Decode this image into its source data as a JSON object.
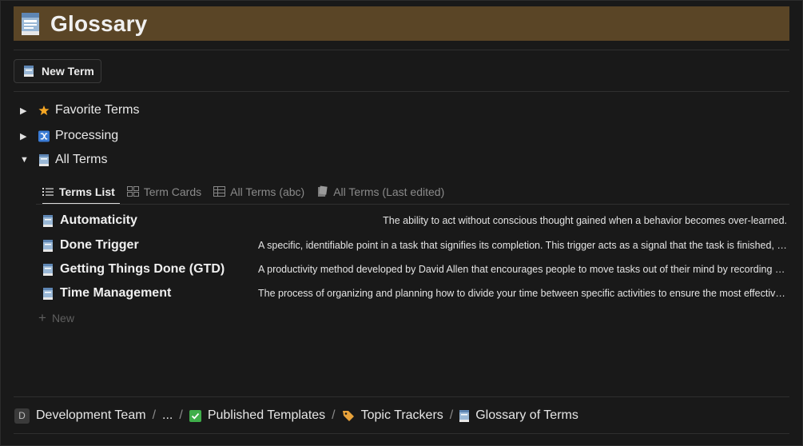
{
  "header": {
    "title": "Glossary",
    "icon": "glossary-book-icon",
    "bg_color": "#5a4526"
  },
  "toolbar": {
    "new_term_label": "New Term"
  },
  "sections": [
    {
      "label": "Favorite Terms",
      "icon": "star-icon",
      "expanded": false
    },
    {
      "label": "Processing",
      "icon": "shuffle-icon",
      "expanded": false
    },
    {
      "label": "All Terms",
      "icon": "glossary-book-icon",
      "expanded": true
    }
  ],
  "tabs": [
    {
      "label": "Terms List",
      "icon": "list-icon",
      "active": true
    },
    {
      "label": "Term Cards",
      "icon": "grid-icon",
      "active": false
    },
    {
      "label": "All Terms (abc)",
      "icon": "table-icon",
      "active": false
    },
    {
      "label": "All Terms (Last edited)",
      "icon": "book-stack-icon",
      "active": false
    }
  ],
  "terms": [
    {
      "name": "Automaticity",
      "description": "The ability to act without conscious thought gained when a behavior becomes over-learned."
    },
    {
      "name": "Done Trigger",
      "description": "A specific, identifiable point in a task that signifies its completion. This trigger acts as a signal that the task is finished, allowing for ..."
    },
    {
      "name": "Getting Things Done (GTD)",
      "description": "A productivity method developed by David Allen that encourages people to move tasks out of their mind by recording them exter..."
    },
    {
      "name": "Time Management",
      "description": "The process of organizing and planning how to divide your time between specific activities to ensure the most effective use of tim..."
    }
  ],
  "new_row_label": "New",
  "breadcrumb": [
    {
      "label": "Development Team",
      "badge": "D"
    },
    {
      "label": "..."
    },
    {
      "label": "Published Templates",
      "icon": "checkbox-icon"
    },
    {
      "label": "Topic Trackers",
      "icon": "tag-icon"
    },
    {
      "label": "Glossary of Terms",
      "icon": "glossary-book-icon"
    }
  ],
  "breadcrumb_separator": "/"
}
